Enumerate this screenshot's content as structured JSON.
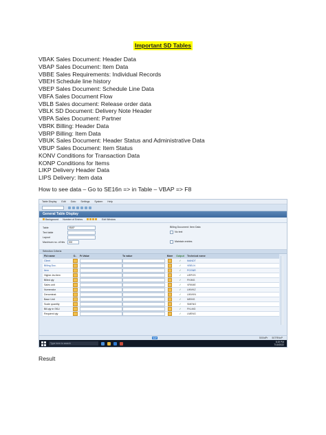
{
  "doc": {
    "title": "Important SD Tables",
    "tables": [
      "VBAK Sales Document: Header Data",
      "VBAP Sales Document: Item Data",
      "VBBE Sales Requirements: Individual Records",
      "VBEH Schedule line history",
      "VBEP Sales Document: Schedule Line Data",
      "VBFA Sales Document Flow",
      "VBLB Sales document: Release order data",
      "VBLK SD Document: Delivery Note Header",
      "VBPA Sales Document: Partner",
      "VBRK Billing: Header Data",
      "VBRP Billing: Item Data",
      "VBUK Sales Document: Header Status and Administrative Data",
      "VBUP Sales Document: Item Status",
      "KONV Conditions for Transaction Data",
      "KONP Conditions for Items",
      "LIKP Delivery Header Data",
      "LIPS Delivery: Item data"
    ],
    "howto": "How to see data – Go to SE16n => in Table – VBAP => F8",
    "result": "Result"
  },
  "sap": {
    "menu": [
      "Table Display",
      "Edit",
      "Goto",
      "Settings",
      "System",
      "Help"
    ],
    "screen_title": "General Table Display",
    "toolbar": [
      "Background",
      "Number of Entries",
      "Exit Window"
    ],
    "form": {
      "table_label": "Table",
      "table_value": "VBAP",
      "text_table_label": "Text table",
      "layout_label": "Layout",
      "max_hits_label": "Maximum no. of hits",
      "max_hits_value": "500",
      "desc": "Billing Document: Item Data",
      "no_text": "No text",
      "maint_entries": "Maintain entries"
    },
    "selection_title": "Selection Criteria",
    "columns": [
      "Fld name",
      "O..",
      "Fr.Value",
      "To value",
      "More",
      "Output",
      "Technical name"
    ],
    "rows": [
      {
        "field": "Client",
        "tech": "MANDT",
        "link": true
      },
      {
        "field": "Billing Doc.",
        "tech": "VBELN",
        "link": true
      },
      {
        "field": "Item",
        "tech": "POSNR",
        "link": true
      },
      {
        "field": "Higher-lev.item",
        "tech": "UEPOS",
        "link": false
      },
      {
        "field": "Billed qty",
        "tech": "FKIMG",
        "link": false
      },
      {
        "field": "Sales unit",
        "tech": "VRKME",
        "link": false
      },
      {
        "field": "Numerator",
        "tech": "UMVKZ",
        "link": false
      },
      {
        "field": "Denominat.",
        "tech": "UMVKN",
        "link": false
      },
      {
        "field": "Base Unit",
        "tech": "MEINS",
        "link": false
      },
      {
        "field": "Scale quantity",
        "tech": "SMENG",
        "link": false
      },
      {
        "field": "Bill.qty in SKU",
        "tech": "FKLMG",
        "link": false
      },
      {
        "field": "Required qty",
        "tech": "LMENG",
        "link": false
      }
    ],
    "status": [
      "500IdPr",
      "50TRNxP"
    ],
    "taskbar": {
      "search": "Type here to search",
      "time": "5:19 PM",
      "date": "7/10/2022"
    }
  }
}
